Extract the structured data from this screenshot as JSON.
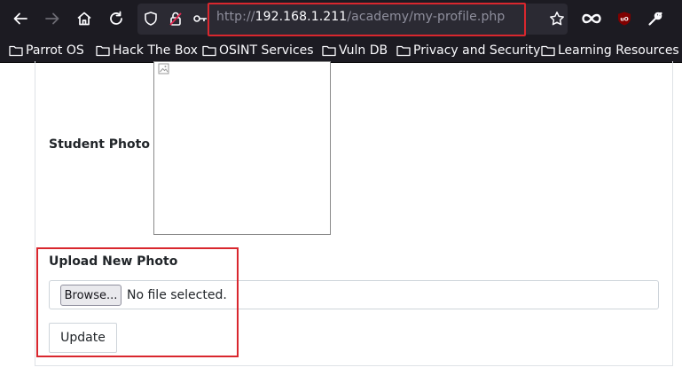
{
  "browser": {
    "url": {
      "scheme": "http://",
      "host": "192.168.1.211",
      "path": "/academy/my-profile.php"
    },
    "toolbar_icons": [
      "back-icon",
      "forward-icon",
      "home-icon",
      "reload-icon",
      "shield-icon",
      "lock-insecure-icon",
      "key-icon",
      "star-icon",
      "infinity-icon",
      "ublock-icon",
      "wrench-icon"
    ],
    "bookmarks": [
      {
        "label": "Parrot OS",
        "icon": "folder-icon"
      },
      {
        "label": "Hack The Box",
        "icon": "folder-icon"
      },
      {
        "label": "OSINT Services",
        "icon": "folder-icon"
      },
      {
        "label": "Vuln DB",
        "icon": "folder-icon"
      },
      {
        "label": "Privacy and Security",
        "icon": "folder-icon"
      },
      {
        "label": "Learning Resources",
        "icon": "folder-icon"
      }
    ],
    "highlight_color": "#d9272e"
  },
  "profile": {
    "photo_label": "Student Photo",
    "upload_label": "Upload New Photo",
    "browse_label": "Browse...",
    "file_status": "No file selected.",
    "update_label": "Update"
  }
}
